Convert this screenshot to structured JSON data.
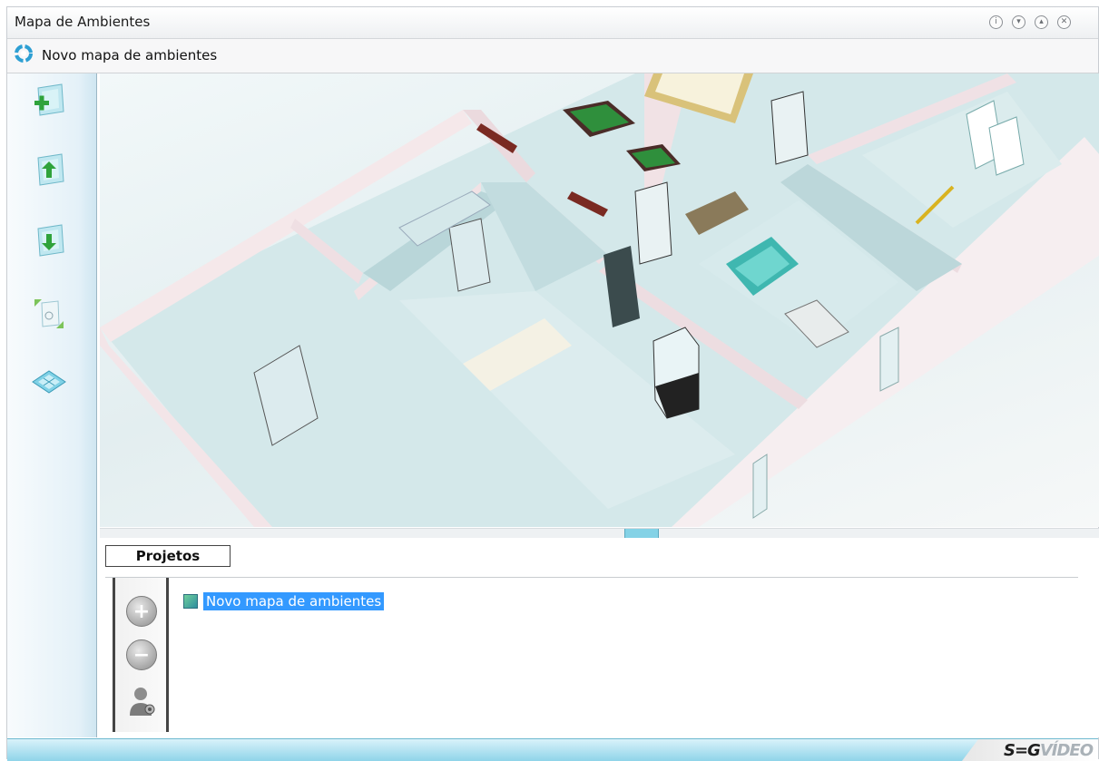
{
  "window": {
    "title": "Mapa de Ambientes",
    "controls": [
      "info-icon",
      "chevron-down-icon",
      "chevron-up-icon",
      "close-icon"
    ]
  },
  "toolbar": {
    "new_map_label": "Novo mapa de ambientes",
    "new_map_icon": "refresh-gear-icon"
  },
  "left_tools": [
    {
      "name": "add-map-icon"
    },
    {
      "name": "upload-map-icon"
    },
    {
      "name": "download-map-icon"
    },
    {
      "name": "resize-map-icon"
    },
    {
      "name": "floor-plan-icon"
    }
  ],
  "projects": {
    "tab_label": "Projetos",
    "items": [
      {
        "label": "Novo mapa de ambientes",
        "selected": true
      }
    ],
    "buttons": [
      "add-icon",
      "remove-icon",
      "user-settings-icon"
    ]
  },
  "brand": {
    "part1": "S=G",
    "part2": "VÍDEO"
  },
  "colors": {
    "accent": "#3399ff",
    "status_bar": "#8fd4e9",
    "wall": "#f1e3e6",
    "floor": "#cfe6e8"
  }
}
